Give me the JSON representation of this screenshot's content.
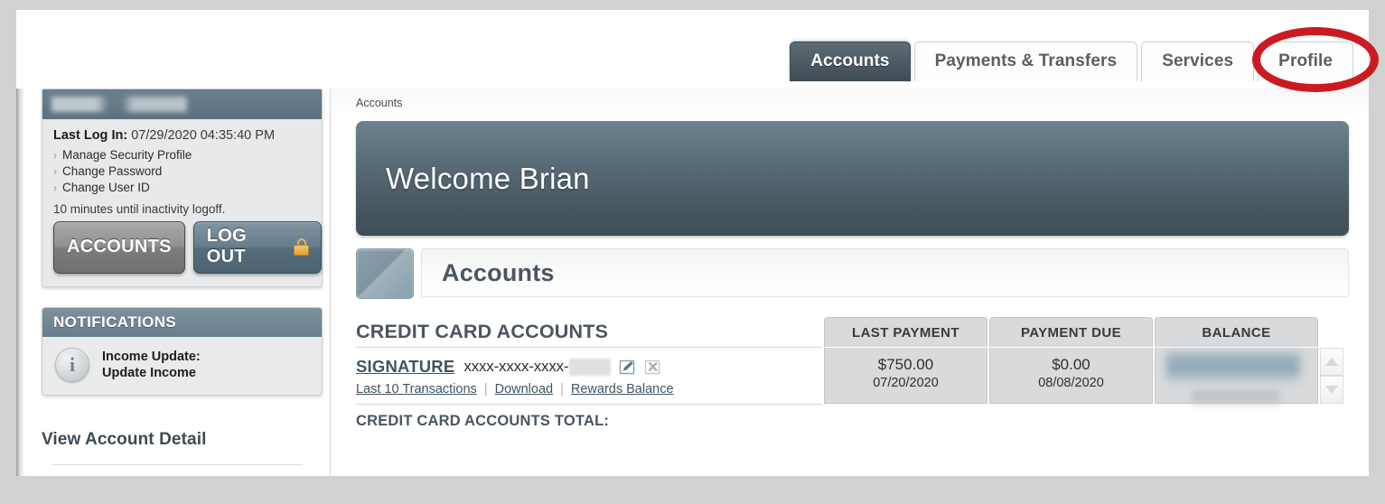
{
  "tabs": [
    {
      "label": "Accounts",
      "active": true
    },
    {
      "label": "Payments & Transfers",
      "active": false
    },
    {
      "label": "Services",
      "active": false
    },
    {
      "label": "Profile",
      "active": false
    }
  ],
  "sidebar": {
    "last_login_label": "Last Log In:",
    "last_login_value": "07/29/2020 04:35:40 PM",
    "links": [
      {
        "label": "Manage Security Profile"
      },
      {
        "label": "Change Password"
      },
      {
        "label": "Change User ID"
      }
    ],
    "inactivity": "10 minutes until inactivity logoff.",
    "accounts_button": "ACCOUNTS",
    "logout_button": "LOG OUT",
    "notifications_title": "NOTIFICATIONS",
    "notification_line1": "Income Update:",
    "notification_line2": "Update Income",
    "info_glyph": "i",
    "view_account_detail": "View Account Detail"
  },
  "main": {
    "breadcrumb": "Accounts",
    "welcome": "Welcome Brian",
    "page_title": "Accounts",
    "section_label": "CREDIT CARD ACCOUNTS",
    "columns": [
      "LAST PAYMENT",
      "PAYMENT DUE",
      "BALANCE"
    ],
    "row": {
      "account_name": "SIGNATURE",
      "account_mask": "xxxx-xxxx-xxxx-",
      "sublinks": [
        "Last 10 Transactions",
        "Download",
        "Rewards Balance"
      ],
      "separator": "|",
      "last_payment_amount": "$750.00",
      "last_payment_date": "07/20/2020",
      "payment_due_amount": "$0.00",
      "payment_due_date": "08/08/2020",
      "balance_amount": "",
      "balance_sub": ""
    },
    "total_label": "CREDIT CARD ACCOUNTS TOTAL:"
  },
  "icons": {
    "edit": "edit-icon",
    "delete": "delete-icon",
    "chevron": "›"
  },
  "colors": {
    "accent_dark": "#4a5862",
    "rail_blue": "#6e8799",
    "annotation_red": "#cc1a21",
    "link_blue": "#3f5463",
    "table_grey": "#d9dadb"
  }
}
